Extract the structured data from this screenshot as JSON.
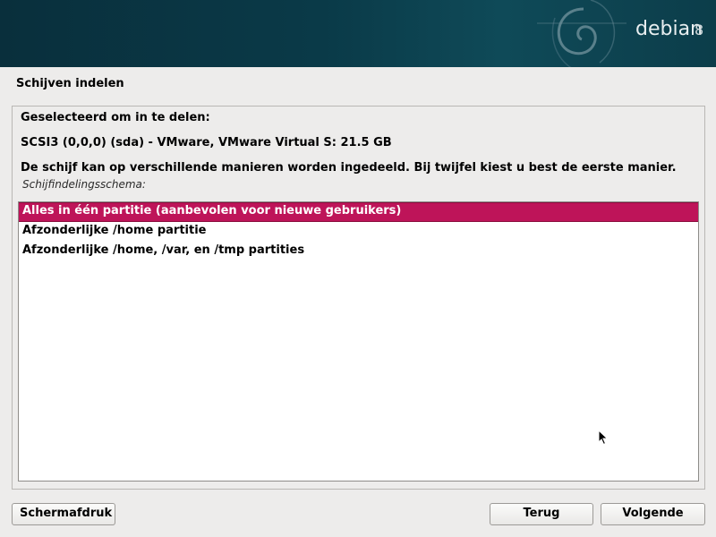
{
  "banner": {
    "logo_text": "debian",
    "logo_version": "8"
  },
  "page": {
    "title": "Schijven indelen"
  },
  "content": {
    "selected_heading": "Geselecteerd om in te delen:",
    "disk": "SCSI3 (0,0,0) (sda) - VMware, VMware Virtual S: 21.5 GB",
    "explanation": "De schijf kan op verschillende manieren worden ingedeeld. Bij twijfel kiest u best de eerste manier.",
    "list_label": "Schijfindelingsschema:"
  },
  "options": [
    {
      "label": "Alles in één partitie (aanbevolen voor nieuwe gebruikers)",
      "selected": true
    },
    {
      "label": "Afzonderlijke /home partitie",
      "selected": false
    },
    {
      "label": "Afzonderlijke /home, /var, en /tmp partities",
      "selected": false
    }
  ],
  "buttons": {
    "screenshot": "Schermafdruk",
    "back": "Terug",
    "next": "Volgende"
  },
  "colors": {
    "banner": "#0a3a48",
    "selection": "#be1459",
    "background": "#edeceb"
  }
}
